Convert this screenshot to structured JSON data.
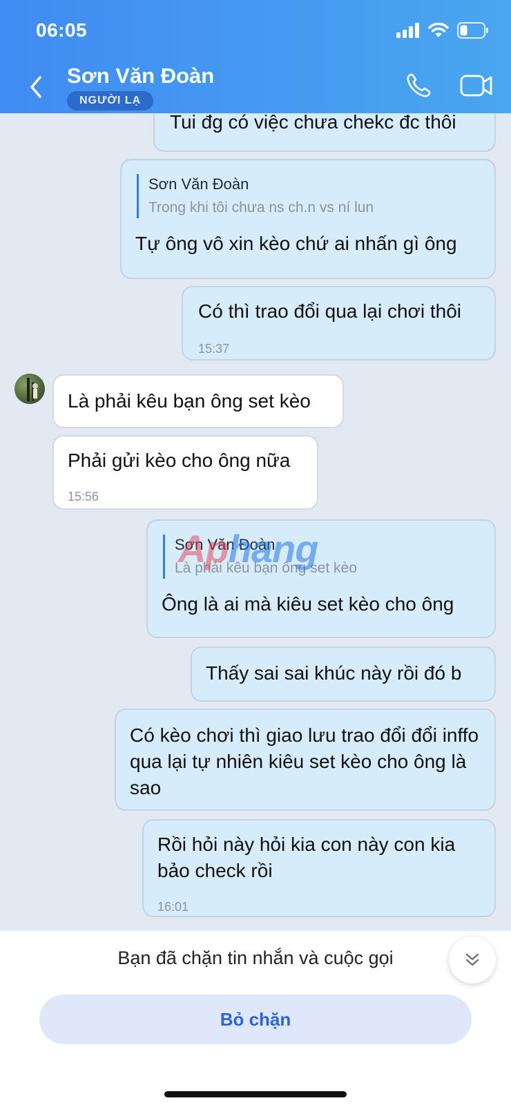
{
  "status_bar": {
    "time": "06:05"
  },
  "header": {
    "contact_name": "Sơn Văn Đoàn",
    "badge": "NGƯỜI LẠ"
  },
  "messages": [
    {
      "text": "Tui đg có việc chưa chekc đc thôi"
    },
    {
      "quote_name": "Sơn Văn Đoàn",
      "quote_text": "Trong khi tôi chưa ns ch.n vs ní lun",
      "text": "Tự ông vô xin kèo chứ ai nhấn gì ông"
    },
    {
      "text": "Có thì trao đổi qua lại chơi thôi",
      "time": "15:37"
    },
    {
      "text": "Là phải kêu bạn ông set kèo"
    },
    {
      "text": "Phải gửi kèo cho ông nữa",
      "time": "15:56"
    },
    {
      "quote_name": "Sơn Văn Đoàn",
      "quote_text": "Là phải kêu bạn ông set kèo",
      "text": "Ông là ai mà kiêu set kèo cho ông"
    },
    {
      "text": "Thấy sai sai khúc này rồi đó b"
    },
    {
      "text": "Có kèo chơi thì giao lưu trao đổi đổi inffo qua lại tự nhiên kiêu set kèo cho ông là sao"
    },
    {
      "text": "Rồi hỏi này hỏi kia con này con kia bảo check rồi",
      "time": "16:01"
    }
  ],
  "watermark": {
    "part1": "Ap",
    "part2": "hang"
  },
  "bottom": {
    "blocked_text": "Bạn đã chặn tin nhắn và cuộc gọi",
    "unblock_label": "Bỏ chặn"
  },
  "colors": {
    "header_start": "#3f8cf2",
    "header_end": "#4aa6f0",
    "accent": "#2b63d9",
    "outgoing_bubble": "#d6ecfb"
  },
  "icons": [
    "back-chevron-icon",
    "phone-icon",
    "video-camera-icon",
    "double-chevron-down-icon",
    "signal-icon",
    "wifi-icon",
    "battery-icon"
  ]
}
